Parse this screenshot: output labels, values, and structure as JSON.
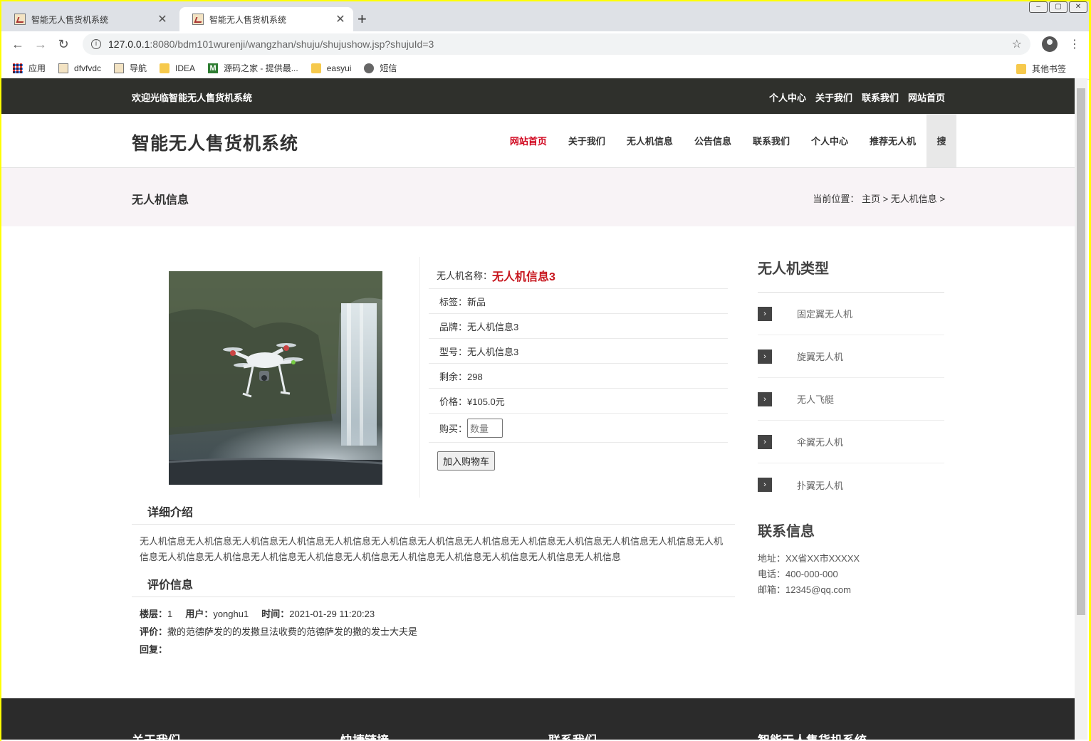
{
  "browser": {
    "tabs": [
      {
        "title": "智能无人售货机系统"
      },
      {
        "title": "智能无人售货机系统"
      }
    ],
    "url_host": "127.0.0.1",
    "url_path": ":8080/bdm101wurenji/wangzhan/shuju/shujushow.jsp?shujuId=3",
    "bookmarks": [
      "应用",
      "dfvfvdc",
      "导航",
      "IDEA",
      "源码之家 - 提供最...",
      "easyui",
      "短信"
    ],
    "other_bookmarks": "其他书签"
  },
  "topbar": {
    "welcome": "欢迎光临智能无人售货机系统",
    "links": [
      "个人中心",
      "关于我们",
      "联系我们",
      "网站首页"
    ]
  },
  "header": {
    "title": "智能无人售货机系统",
    "nav": [
      "网站首页",
      "关于我们",
      "无人机信息",
      "公告信息",
      "联系我们",
      "个人中心",
      "推荐无人机"
    ],
    "search": "搜"
  },
  "banner": {
    "title": "无人机信息",
    "breadcrumb": "当前位置： 主页 > 无人机信息 >"
  },
  "product": {
    "name_label": "无人机名称：",
    "name": "无人机信息3",
    "tag": "标签：新品",
    "brand": "品牌：无人机信息3",
    "model": "型号：无人机信息3",
    "stock": "剩余：298",
    "price": "价格：¥105.0元",
    "buy_label": "购买：",
    "qty_placeholder": "数量",
    "cart_button": "加入购物车"
  },
  "detail": {
    "title": "详细介绍",
    "text": "无人机信息无人机信息无人机信息无人机信息无人机信息无人机信息无人机信息无人机信息无人机信息无人机信息无人机信息无人机信息无人机信息无人机信息无人机信息无人机信息无人机信息无人机信息无人机信息无人机信息无人机信息无人机信息无人机信息"
  },
  "reviews": {
    "title": "评价信息",
    "items": [
      {
        "floor_label": "楼层：",
        "floor": "1",
        "user_label": "用户：",
        "user": "yonghu1",
        "time_label": "时间：",
        "time": "2021-01-29 11:20:23",
        "rating_label": "评价：",
        "rating": "撒的范德萨发的的发撒旦法收费的范德萨发的撒的发士大夫是",
        "reply_label": "回复：",
        "reply": ""
      }
    ]
  },
  "sidebar": {
    "category_title": "无人机类型",
    "categories": [
      "固定翼无人机",
      "旋翼无人机",
      "无人飞艇",
      "伞翼无人机",
      "扑翼无人机"
    ],
    "contact_title": "联系信息",
    "address": "地址：XX省XX市XXXXX",
    "phone": "电话：400-000-000",
    "email": "邮箱：12345@qq.com"
  },
  "footer": {
    "headings": [
      "关于我们",
      "快捷链接",
      "联系我们",
      "智能无人售货机系统"
    ]
  }
}
